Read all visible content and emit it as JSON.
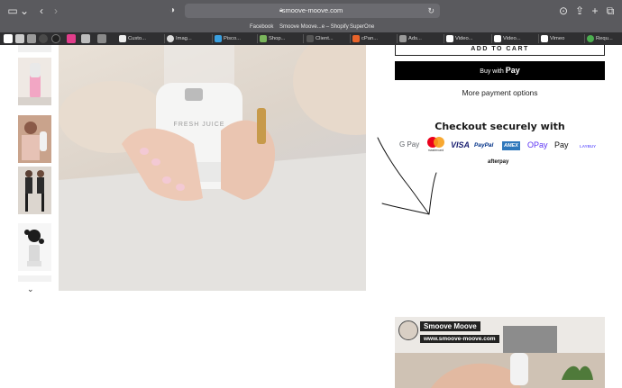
{
  "browser": {
    "url": "smoove-moove.com",
    "favorites": [
      "Facebook",
      "Smoove Moove...e – Shopify",
      "SuperOne"
    ],
    "tabs": [
      "Custo...",
      "Imag...",
      "Pisco...",
      "Shop...",
      "Client...",
      "cPan...",
      "Ads...",
      "Video...",
      "Video...",
      "Vimeo",
      "Requ..."
    ]
  },
  "product": {
    "add_to_cart_label": "ADD TO CART",
    "buy_with_label": "Buy with",
    "buy_with_brand": "Pay",
    "more_payment_label": "More payment options",
    "checkout_title": "Checkout securely with",
    "payment_methods": [
      "G Pay",
      "mastercard",
      "VISA",
      "PayPal",
      "AMEX",
      "OPay",
      "Pay",
      "LAYBUY"
    ],
    "afterpay_label": "afterpay",
    "bottle_brand": "FRESH JUICE"
  },
  "video": {
    "channel_name": "Smoove Moove",
    "channel_url": "www.smoove-moove.com"
  },
  "colors": {
    "chrome": "#5a5a5e",
    "tabbar": "#2f2f31",
    "buy_button": "#000000"
  }
}
